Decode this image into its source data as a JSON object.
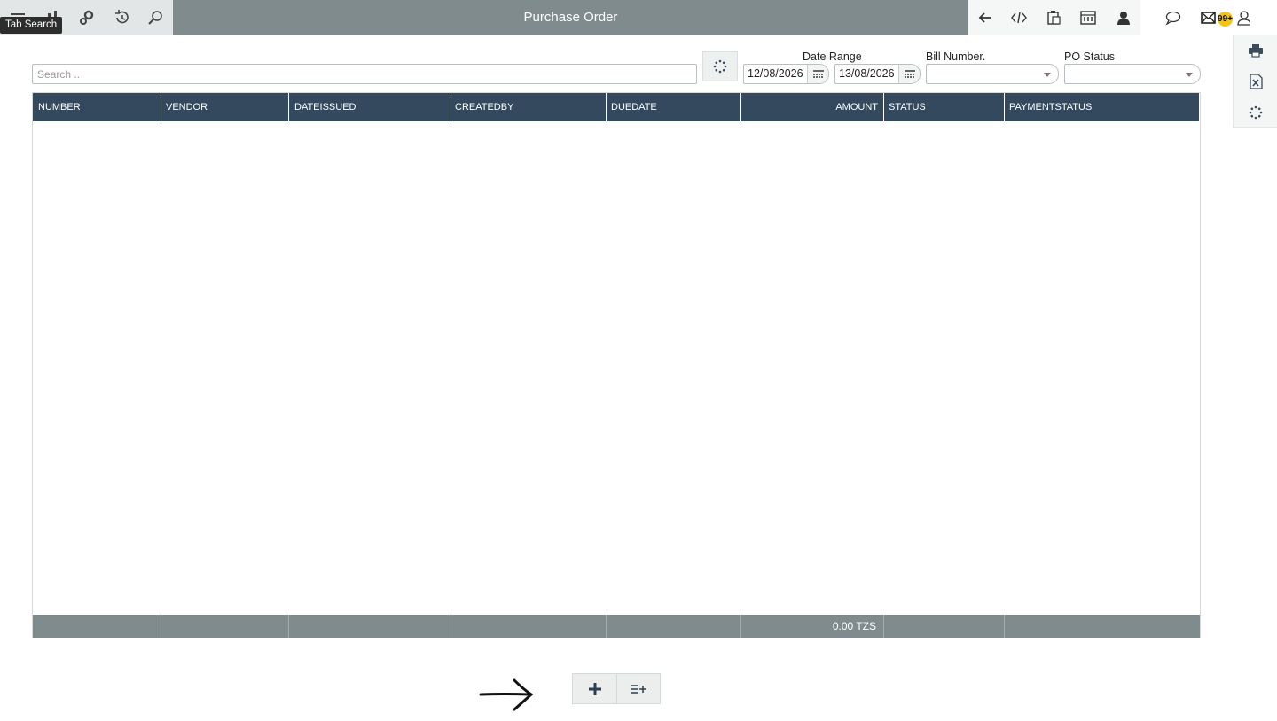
{
  "topbar": {
    "title": "Purchase Order",
    "tooltip": "Tab Search",
    "left_icons": [
      "menu-icon",
      "apps-icon",
      "settings-gears-icon",
      "history-icon",
      "search-icon"
    ],
    "right_icons": [
      "back-arrow-icon",
      "code-icon",
      "clipboard-icon",
      "calculator-icon",
      "user-icon",
      "chat-icon",
      "mail-icon",
      "profile-icon"
    ],
    "notification_count": "99+"
  },
  "side_tools": [
    "print-icon",
    "excel-export-icon",
    "refresh-icon"
  ],
  "filters": {
    "search_placeholder": "Search ..",
    "date_range_label": "Date Range",
    "date_from": "12/08/2026",
    "date_to": "13/08/2026",
    "bill_number_label": "Bill Number.",
    "bill_number_value": "",
    "po_status_label": "PO Status",
    "po_status_value": ""
  },
  "grid": {
    "columns": [
      {
        "key": "number",
        "label": "NUMBER"
      },
      {
        "key": "vendor",
        "label": "VENDOR"
      },
      {
        "key": "dateissued",
        "label": "DATEISSUED"
      },
      {
        "key": "createdby",
        "label": "CREATEDBY"
      },
      {
        "key": "duedate",
        "label": "DUEDATE"
      },
      {
        "key": "amount",
        "label": "AMOUNT"
      },
      {
        "key": "status",
        "label": "STATUS"
      },
      {
        "key": "paymentstatus",
        "label": "PAYMENTSTATUS"
      }
    ],
    "rows": [],
    "footer_total": "0.00 TZS"
  },
  "colors": {
    "topbar": "#7f8b8d",
    "grid_header": "#34495e",
    "grid_footer": "#7f8b8d",
    "badge": "#f2c417"
  },
  "actions": [
    "add-icon",
    "add-list-icon"
  ]
}
